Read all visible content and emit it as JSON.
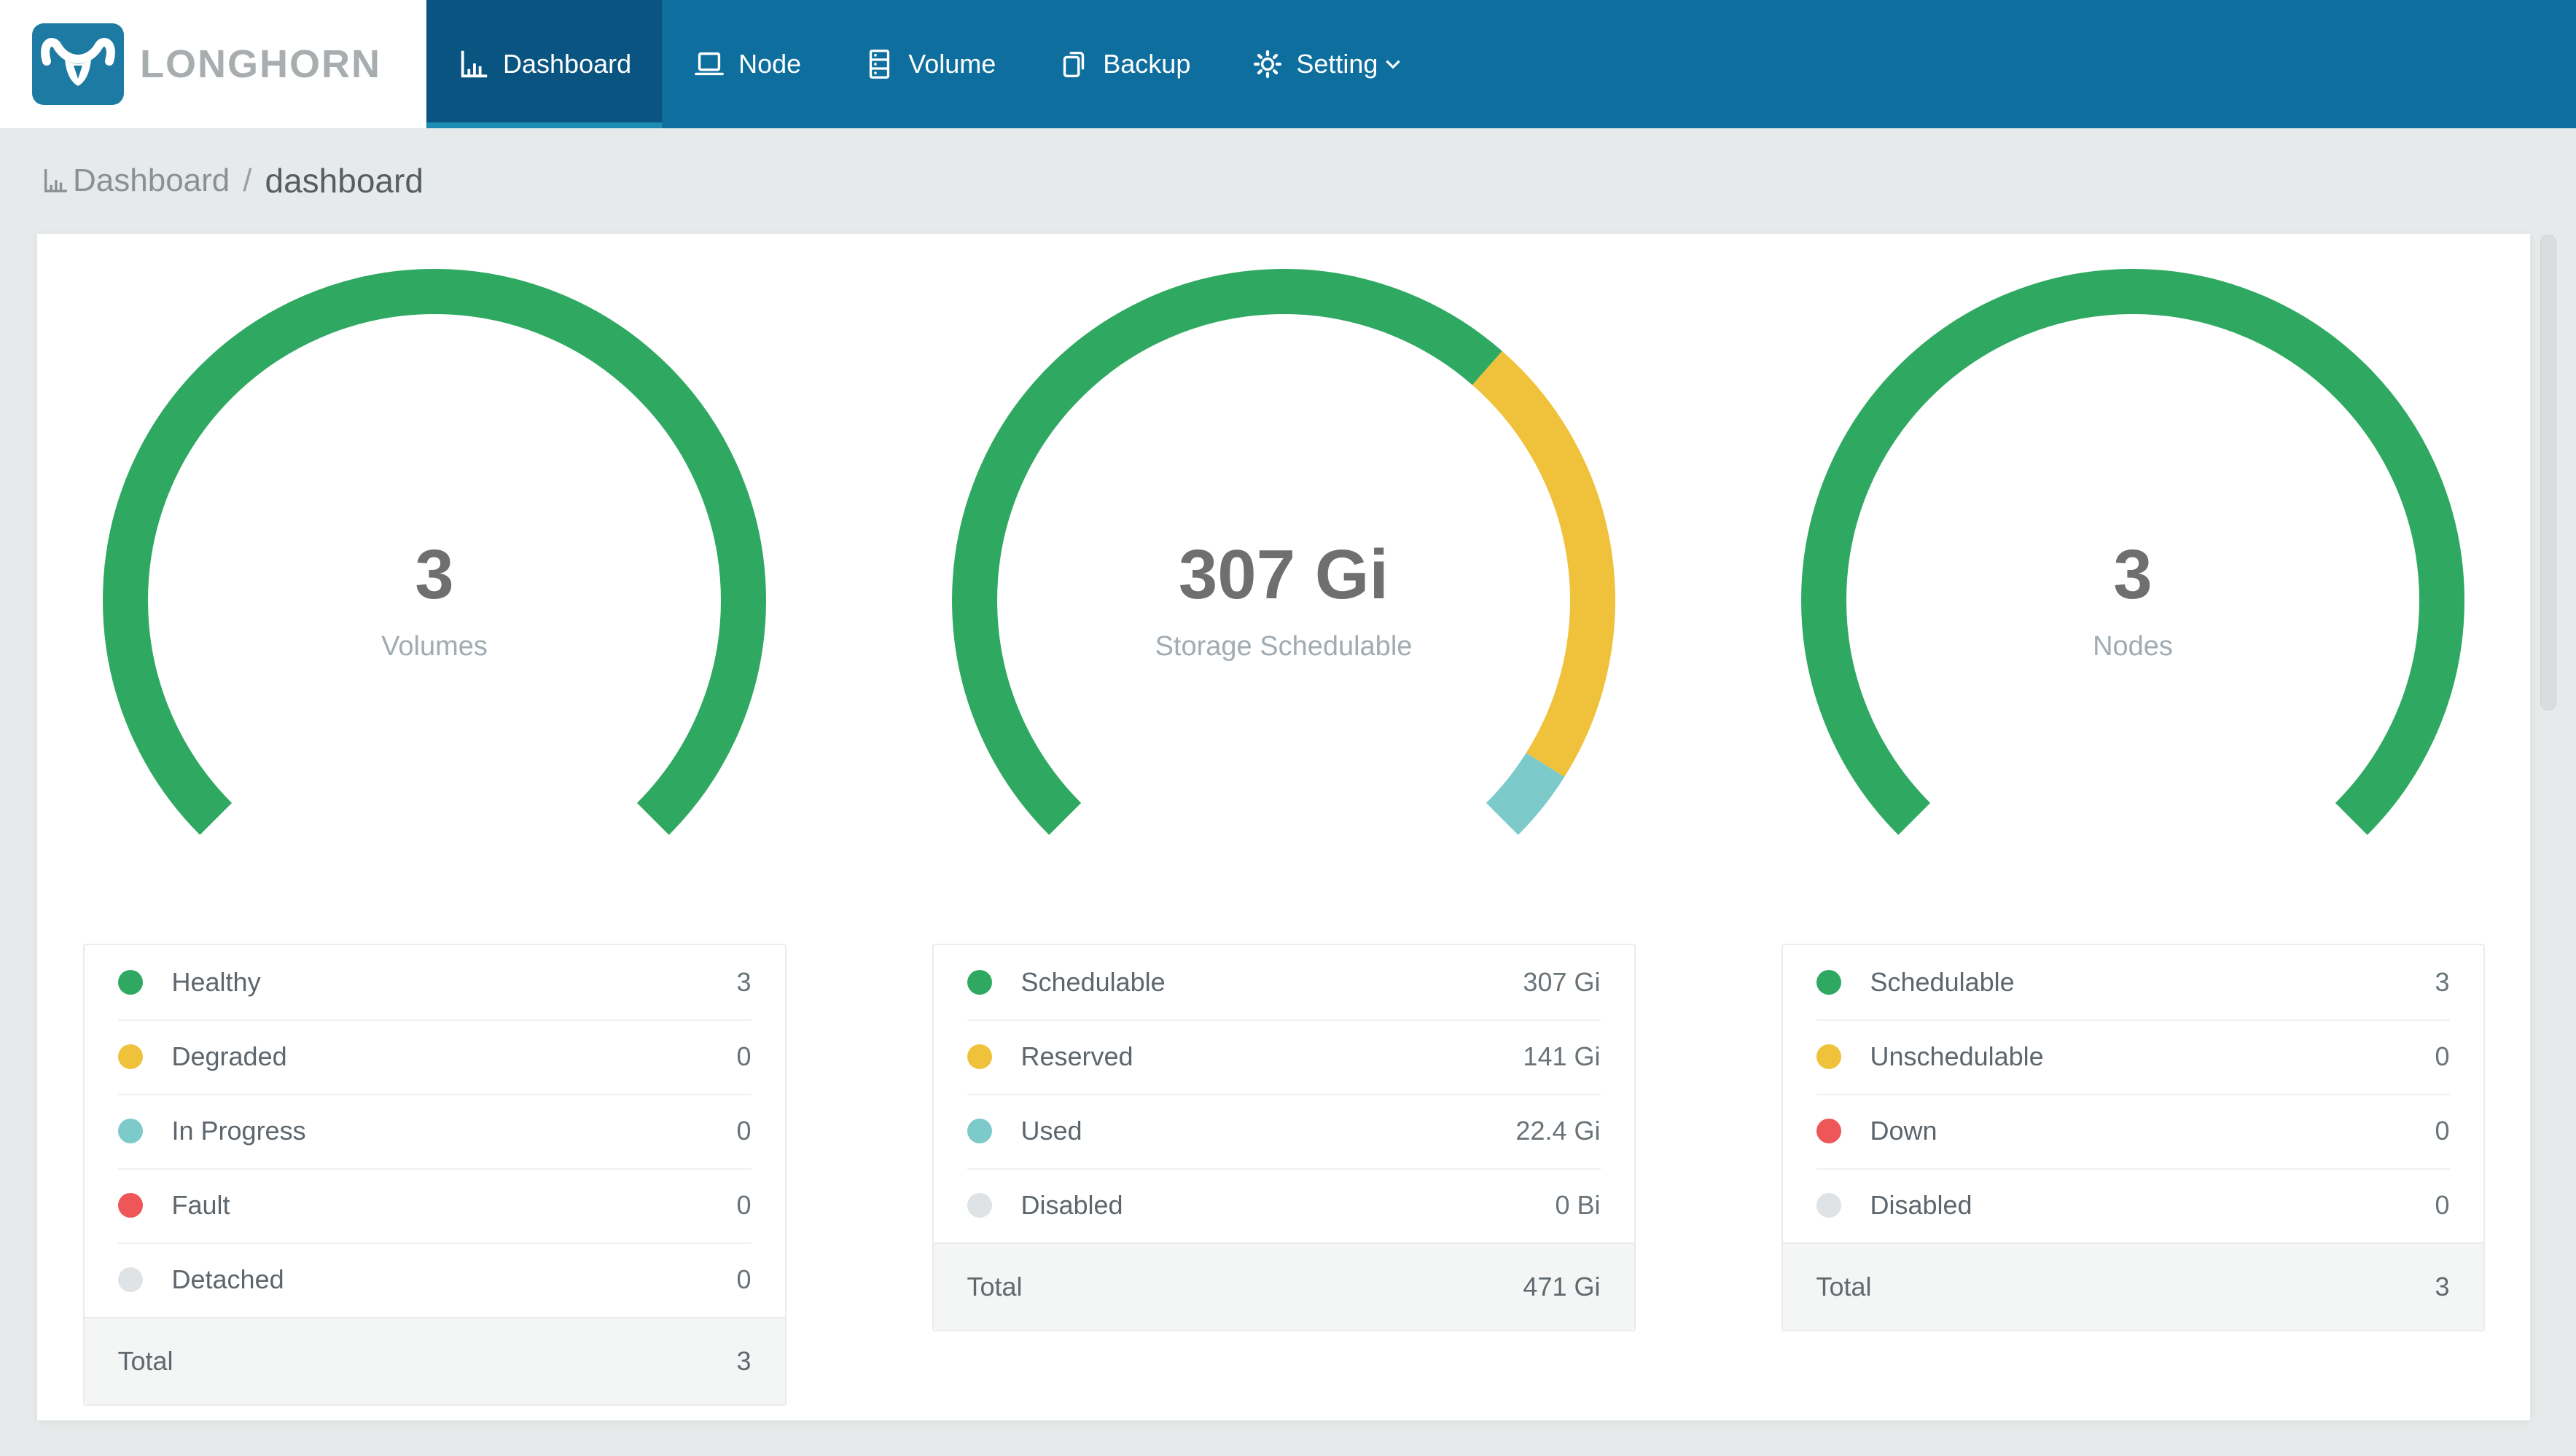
{
  "brand": {
    "name": "LONGHORN"
  },
  "nav": {
    "items": [
      {
        "label": "Dashboard",
        "icon": "bar-chart-icon",
        "active": true
      },
      {
        "label": "Node",
        "icon": "laptop-icon",
        "active": false
      },
      {
        "label": "Volume",
        "icon": "server-stack-icon",
        "active": false
      },
      {
        "label": "Backup",
        "icon": "copy-icon",
        "active": false
      },
      {
        "label": "Setting",
        "icon": "gear-icon",
        "active": false,
        "has_dropdown": true
      }
    ]
  },
  "breadcrumb": {
    "section": "Dashboard",
    "separator": "/",
    "page": "dashboard"
  },
  "colors": {
    "nav_bg": "#0e6f9e",
    "nav_active_bg": "#095480",
    "nav_active_underline": "#1d8cb5",
    "green": "#2fa961",
    "yellow": "#f0c13a",
    "teal": "#7dcaca",
    "red": "#ef5657",
    "gray": "#dfe3e5",
    "page_bg": "#e7eaea"
  },
  "chart_data": [
    {
      "type": "donut-gauge",
      "id": "volumes",
      "center_value": "3",
      "center_label": "Volumes",
      "start_angle": -135,
      "sweep": 270,
      "series": [
        {
          "name": "Healthy",
          "value": 3,
          "display": "3",
          "color": "#2fa961"
        },
        {
          "name": "Degraded",
          "value": 0,
          "display": "0",
          "color": "#f0c13a"
        },
        {
          "name": "In Progress",
          "value": 0,
          "display": "0",
          "color": "#7dcaca"
        },
        {
          "name": "Fault",
          "value": 0,
          "display": "0",
          "color": "#ef5657"
        },
        {
          "name": "Detached",
          "value": 0,
          "display": "0",
          "color": "#dfe3e5"
        }
      ],
      "total": {
        "label": "Total",
        "display": "3"
      }
    },
    {
      "type": "donut-gauge",
      "id": "storage-schedulable",
      "center_value": "307 Gi",
      "center_label": "Storage Schedulable",
      "start_angle": -135,
      "sweep": 270,
      "series": [
        {
          "name": "Schedulable",
          "value": 307,
          "display": "307 Gi",
          "color": "#2fa961"
        },
        {
          "name": "Reserved",
          "value": 141,
          "display": "141 Gi",
          "color": "#f0c13a"
        },
        {
          "name": "Used",
          "value": 22.4,
          "display": "22.4 Gi",
          "color": "#7dcaca"
        },
        {
          "name": "Disabled",
          "value": 0,
          "display": "0 Bi",
          "color": "#dfe3e5"
        }
      ],
      "total": {
        "label": "Total",
        "display": "471 Gi"
      }
    },
    {
      "type": "donut-gauge",
      "id": "nodes",
      "center_value": "3",
      "center_label": "Nodes",
      "start_angle": -135,
      "sweep": 270,
      "series": [
        {
          "name": "Schedulable",
          "value": 3,
          "display": "3",
          "color": "#2fa961"
        },
        {
          "name": "Unschedulable",
          "value": 0,
          "display": "0",
          "color": "#f0c13a"
        },
        {
          "name": "Down",
          "value": 0,
          "display": "0",
          "color": "#ef5657"
        },
        {
          "name": "Disabled",
          "value": 0,
          "display": "0",
          "color": "#dfe3e5"
        }
      ],
      "total": {
        "label": "Total",
        "display": "3"
      }
    }
  ]
}
